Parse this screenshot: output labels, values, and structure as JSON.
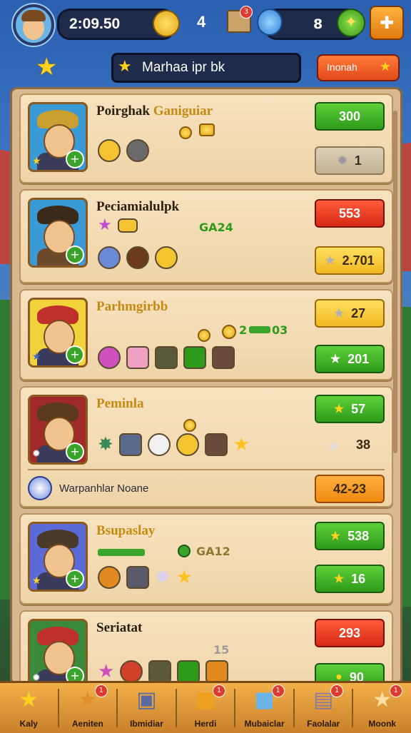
{
  "hud": {
    "coins": "2:09.50",
    "middle_count": "4",
    "crate_badge": "3",
    "gems": "8",
    "title": "Marhaa ipr bk",
    "mode_button": "Inonah"
  },
  "cards": [
    {
      "name": "Poirghak",
      "name_gold": "Ganiguiar",
      "btn1": "300",
      "btn2": "1"
    },
    {
      "name": "Peciamialulpk",
      "green_text": "GA24",
      "btn1": "553",
      "btn2": "2.701"
    },
    {
      "name": "Parhmgirbb",
      "green_text": "2",
      "green_text2": "03",
      "btn1": "27",
      "btn2": "201"
    },
    {
      "name": "Peminla",
      "btn1": "57",
      "value": "38",
      "hint": "Warpanhlar Noane",
      "hint_btn": "42-23"
    },
    {
      "name": "Bsupaslay",
      "green_text": "GA12",
      "btn1": "538",
      "btn2": "16"
    },
    {
      "name": "Seriatat",
      "green_text": "15",
      "btn1": "293",
      "btn2": "90"
    }
  ],
  "nav": [
    {
      "label": "Kaly",
      "icon": "star-icon"
    },
    {
      "label": "Aeniten",
      "icon": "star-badge-icon",
      "badge": "1"
    },
    {
      "label": "Ibmidiar",
      "icon": "book-icon"
    },
    {
      "label": "Herdi",
      "icon": "crate-icon",
      "badge": "1"
    },
    {
      "label": "Mubaiclar",
      "icon": "box-icon",
      "badge": "1"
    },
    {
      "label": "Faolalar",
      "icon": "chest-icon",
      "badge": "1"
    },
    {
      "label": "Moonk",
      "icon": "star-icon",
      "badge": "1"
    }
  ]
}
